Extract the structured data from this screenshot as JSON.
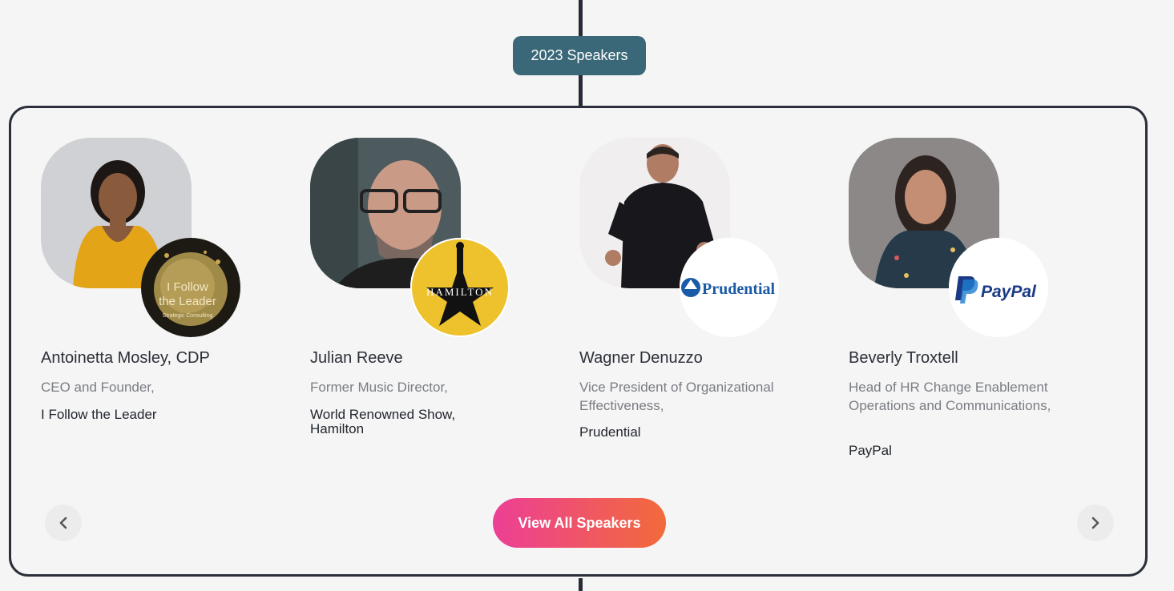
{
  "header": {
    "badge_label": "2023 Speakers"
  },
  "speakers": [
    {
      "name": "Antoinetta Mosley, CDP",
      "role": "CEO and Founder,",
      "company": "I Follow the Leader",
      "logo_lines": [
        "I Follow",
        "the Leader",
        "Strategic Consulting"
      ]
    },
    {
      "name": "Julian Reeve",
      "role": "Former Music Director,",
      "company": "World Renowned Show, Hamilton",
      "logo_text": "HAMILTON"
    },
    {
      "name": "Wagner Denuzzo",
      "role": "Vice President of Organizational Effectiveness,",
      "company": "Prudential",
      "logo_text": "Prudential"
    },
    {
      "name": "Beverly Troxtell",
      "role": "Head of HR Change Enablement Operations and Communications,",
      "company": "PayPal",
      "logo_text": "PayPal"
    }
  ],
  "footer": {
    "view_all_label": "View All Speakers"
  },
  "icons": {
    "prev": "chevron-left-icon",
    "next": "chevron-right-icon"
  },
  "colors": {
    "badge": "#3a6878",
    "panel_border": "#2a2f3a",
    "button_gradient_start": "#ec3f96",
    "button_gradient_end": "#f26a3a"
  }
}
